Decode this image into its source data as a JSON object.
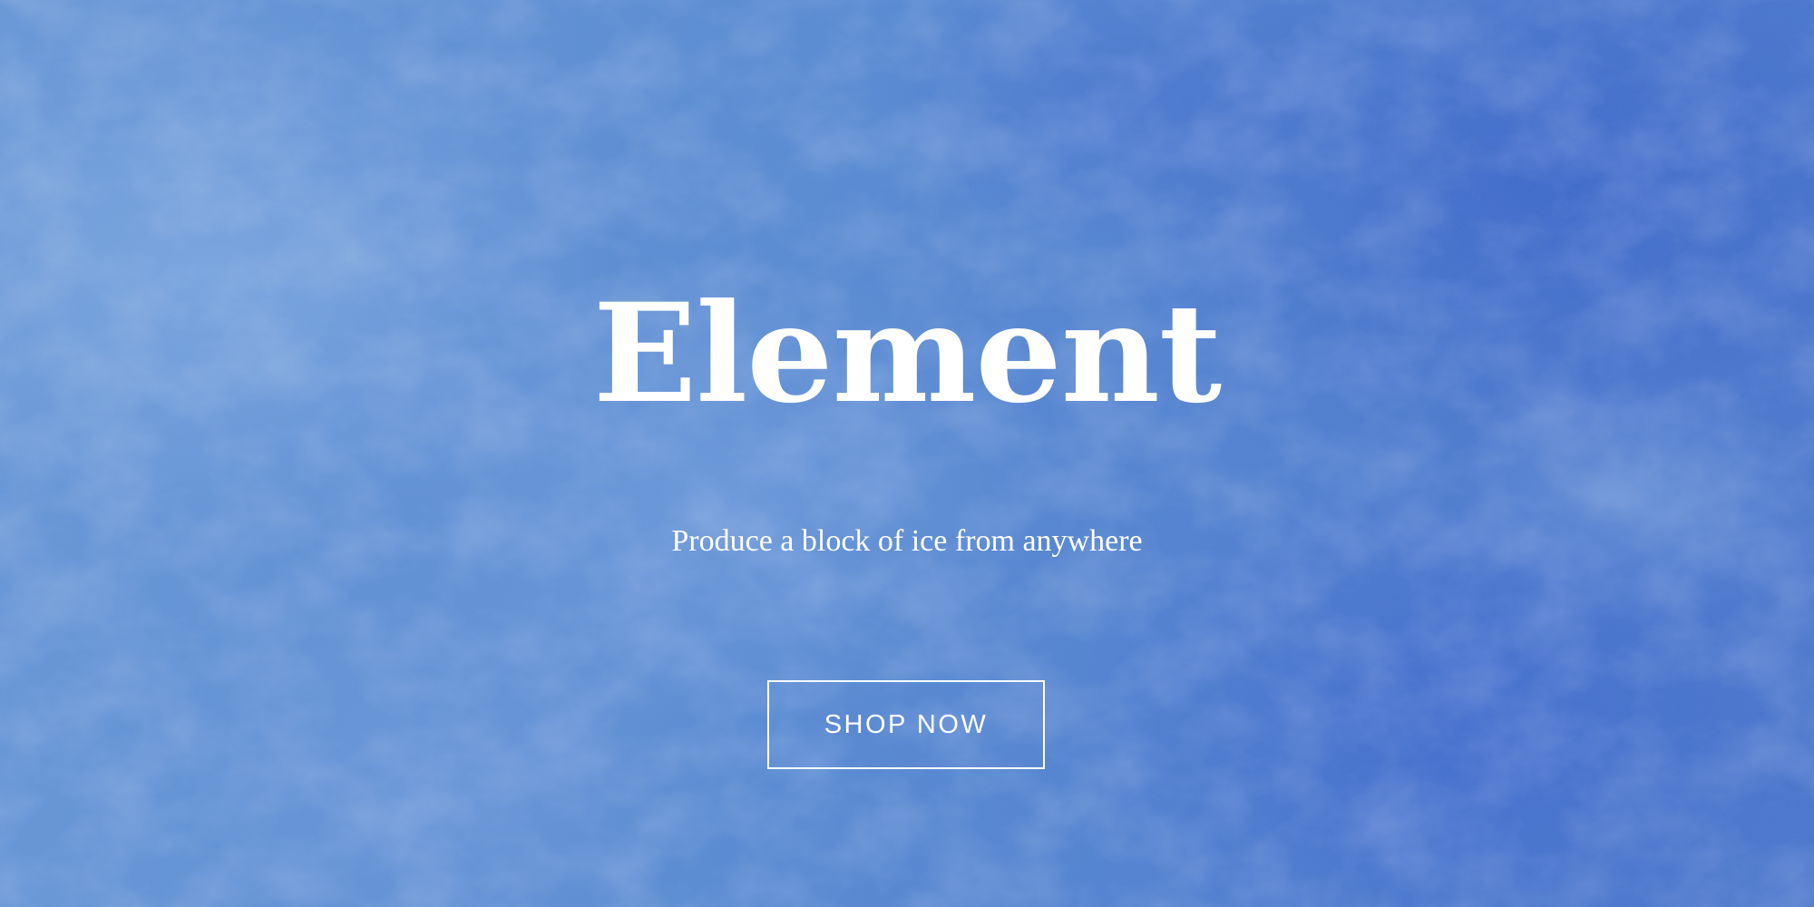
{
  "hero": {
    "title": "Element",
    "subtitle": "Produce a block of ice from anywhere",
    "cta_label": "SHOP NOW"
  },
  "colors": {
    "background_base": "#5a86cf",
    "text": "#ffffff",
    "button_border": "#ffffff"
  }
}
